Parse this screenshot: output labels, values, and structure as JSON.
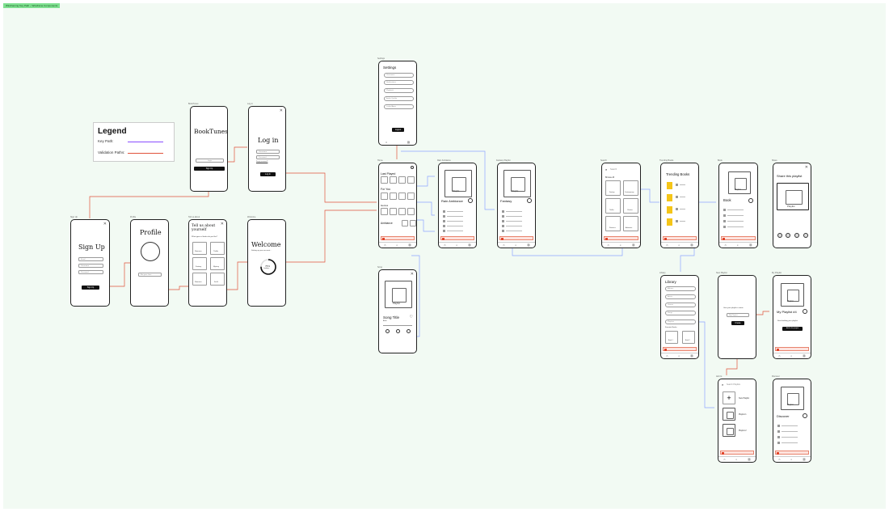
{
  "canvas_tag": "Wireframing Key Path – Wireframe Components",
  "legend": {
    "title": "Legend",
    "items": [
      {
        "label": "Key Path:",
        "color": "#8a4dff"
      },
      {
        "label": "Validation Paths:",
        "color": "#e0533b"
      }
    ]
  },
  "colors": {
    "key_path": "#8a4dff",
    "validation_path": "#e0533b",
    "blue_path": "#8fa4ff",
    "canvas": "#f2faf3",
    "accent": "#e2442a",
    "trending": "#f5c518"
  },
  "screens": {
    "signup": {
      "label": "Sign Up",
      "title": "Sign Up",
      "fields": [
        "Email",
        "Username",
        "Password"
      ],
      "button": "Sign Up"
    },
    "profile": {
      "label": "Profile",
      "title": "Profile",
      "field": "Bio goes here"
    },
    "tellus": {
      "label": "Tell us about",
      "title": "Tell us about yourself",
      "subtitle": "What types of books do you like?",
      "genres": [
        "Romance",
        "Thriller",
        "Fantasy",
        "Mystery",
        "Romance",
        "Sci-Fi"
      ]
    },
    "welcome": {
      "label": "Welcome",
      "title": "Welcome",
      "subtitle": "Setting up your account...",
      "progress_text": "75%",
      "progress_sub": "Loading...",
      "progress": 0.75
    },
    "booktunes": {
      "label": "BookTunes",
      "title": "BookTunes",
      "field": "Login",
      "button": "Sign Up"
    },
    "login": {
      "label": "Log in",
      "title": "Log in",
      "fields": [
        "Username",
        "Password"
      ],
      "link": "Forgot password?",
      "button": "Log In"
    },
    "settings": {
      "label": "Settings",
      "title": "Settings",
      "items": [
        "Username",
        "Notifications",
        "Playback",
        "Audio Quality",
        "Linked Apps"
      ],
      "button": "Logout"
    },
    "home": {
      "label": "Home",
      "sections": [
        "Last Played",
        "For You",
        "Genres",
        "Ambiance"
      ]
    },
    "song": {
      "label": "Song",
      "art_label": "Playlist",
      "title": "Song Title",
      "artist": "Artist"
    },
    "rain": {
      "label": "Rain Ambiance",
      "art_label": "Playlist",
      "title": "Rain Ambiance"
    },
    "fantasy": {
      "label": "Fantasy Playlist",
      "art_label": "Playlist",
      "title": "Fantasy"
    },
    "search": {
      "label": "Search",
      "placeholder": "Search",
      "section": "Browse All",
      "tiles": [
        "Fantasy",
        "Contemporary",
        "Thriller",
        "Classics",
        "Romance",
        "Adventure"
      ]
    },
    "trending": {
      "label": "Trending Books",
      "title": "Trending Books"
    },
    "book": {
      "label": "Book",
      "art_label": "Playlist",
      "title": "Book"
    },
    "share": {
      "label": "Share",
      "title": "Share this playlist",
      "art_label": "Playlist"
    },
    "library": {
      "label": "Library",
      "title": "Library",
      "items": [
        "Albums",
        "Artists",
        "Genres",
        "Songs",
        "Playlists"
      ],
      "section": "Favorite Books",
      "books": [
        "Book 1",
        "Book 2"
      ]
    },
    "newplaylist": {
      "label": "New Playlist",
      "prompt": "Give your playlist a name",
      "field": "My Playlist",
      "button": "Create"
    },
    "myplaylist": {
      "label": "My Playlist",
      "art_label": "Playlist",
      "title": "My Playlist #4",
      "note": "Start building your playlist",
      "button": "Add to this playlist"
    },
    "addto": {
      "label": "Add to",
      "placeholder": "Search Playlists",
      "items": [
        "New Playlist",
        "Playlist 1",
        "Playlist 2"
      ]
    },
    "discover": {
      "label": "Discover",
      "art_label": "Playlist",
      "title": "Discover"
    }
  }
}
